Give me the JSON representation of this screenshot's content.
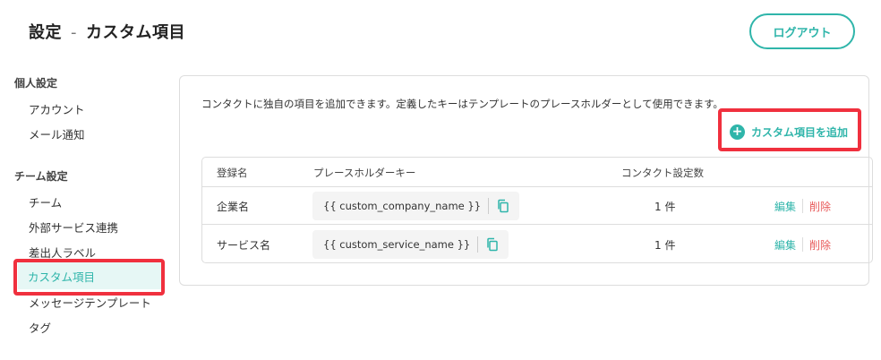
{
  "header": {
    "title_main": "設定",
    "title_sep": "-",
    "title_sub": "カスタム項目",
    "logout_label": "ログアウト"
  },
  "sidebar": {
    "personal_heading": "個人設定",
    "personal_items": [
      "アカウント",
      "メール通知"
    ],
    "team_heading": "チーム設定",
    "team_items": [
      "チーム",
      "外部サービス連携",
      "差出人ラベル",
      "カスタム項目",
      "メッセージテンプレート",
      "タグ"
    ],
    "active_item": "カスタム項目"
  },
  "main": {
    "description": "コンタクトに独自の項目を追加できます。定義したキーはテンプレートのプレースホルダーとして使用できます。",
    "add_button_label": "カスタム項目を追加",
    "add_icon_glyph": "+",
    "table": {
      "headers": [
        "登録名",
        "プレースホルダーキー",
        "コンタクト設定数"
      ],
      "rows": [
        {
          "name": "企業名",
          "key": "{{ custom_company_name }}",
          "count": "1 件",
          "edit": "編集",
          "delete": "削除"
        },
        {
          "name": "サービス名",
          "key": "{{ custom_service_name }}",
          "count": "1 件",
          "edit": "編集",
          "delete": "削除"
        }
      ]
    }
  },
  "colors": {
    "accent": "#2fb5aa",
    "danger": "#e85a5a",
    "highlight": "#f0303e",
    "active_bg": "#e6f7f5"
  },
  "icons": {
    "copy": "copy-icon",
    "add": "plus-circle-icon"
  }
}
